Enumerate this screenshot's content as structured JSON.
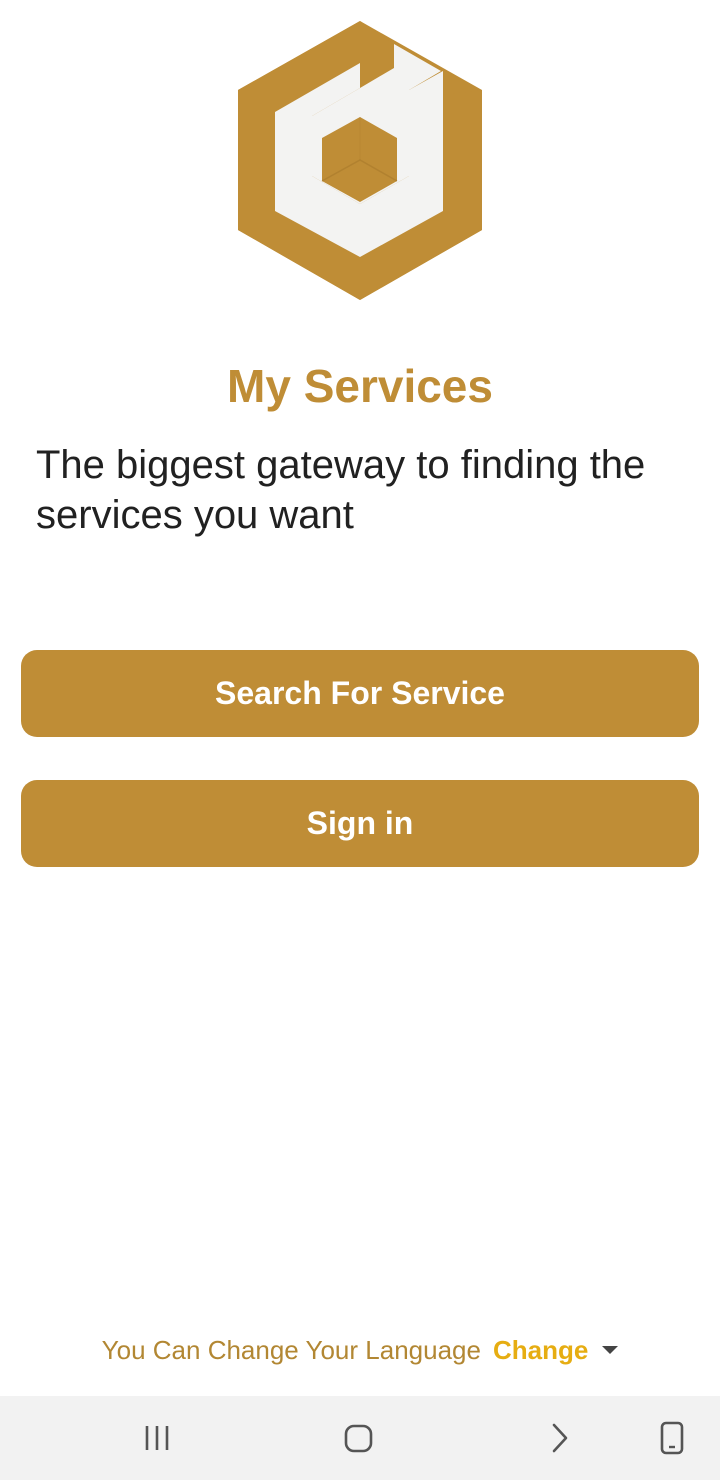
{
  "app": {
    "title": "My Services",
    "tagline": "The biggest gateway to finding the services you want",
    "logo_icon": "hexagon-cube-logo-icon",
    "brand_color": "#bf8d36",
    "logo_light_color": "#f3f3f2"
  },
  "actions": {
    "search_label": "Search For Service",
    "signin_label": "Sign in"
  },
  "language": {
    "prompt": "You Can Change Your Language",
    "change_label": "Change",
    "dropdown_icon": "caret-down-icon",
    "change_color": "#e6ad12"
  },
  "navbar": {
    "background": "#f2f2f2",
    "items": [
      {
        "icon": "recent-apps-icon"
      },
      {
        "icon": "home-icon"
      },
      {
        "icon": "back-icon"
      },
      {
        "icon": "rotate-screen-icon"
      }
    ]
  }
}
